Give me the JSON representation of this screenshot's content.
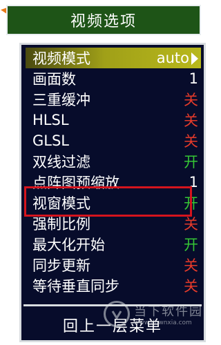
{
  "title": "视频选项",
  "menu": {
    "items": [
      {
        "label": "视频模式",
        "value": "auto",
        "value_color": "white",
        "selected": true,
        "has_arrow": true
      },
      {
        "label": "画面数",
        "value": "1",
        "value_color": "white"
      },
      {
        "label": "三重缓冲",
        "value": "关",
        "value_color": "red"
      },
      {
        "label": "HLSL",
        "value": "关",
        "value_color": "red"
      },
      {
        "label": "GLSL",
        "value": "关",
        "value_color": "red"
      },
      {
        "label": "双线过滤",
        "value": "开",
        "value_color": "green"
      },
      {
        "label": "点阵图预缩放",
        "value": "1",
        "value_color": "white"
      },
      {
        "label": "视窗模式",
        "value": "开",
        "value_color": "green",
        "highlighted": true
      },
      {
        "label": "强制比例",
        "value": "关",
        "value_color": "red"
      },
      {
        "label": "最大化开始",
        "value": "开",
        "value_color": "green"
      },
      {
        "label": "同步更新",
        "value": "关",
        "value_color": "red"
      },
      {
        "label": "等待垂直同步",
        "value": "关",
        "value_color": "red"
      }
    ]
  },
  "footer": {
    "back_label": "回上一层菜单"
  },
  "watermark": {
    "text": "当下软件园",
    "sub": "www.downxia.com"
  },
  "colors": {
    "title_bg": "#1e5417",
    "panel_bg": "#070c2b",
    "on": "#35c635",
    "off": "#e43a2a",
    "highlight": "#d5141d"
  }
}
